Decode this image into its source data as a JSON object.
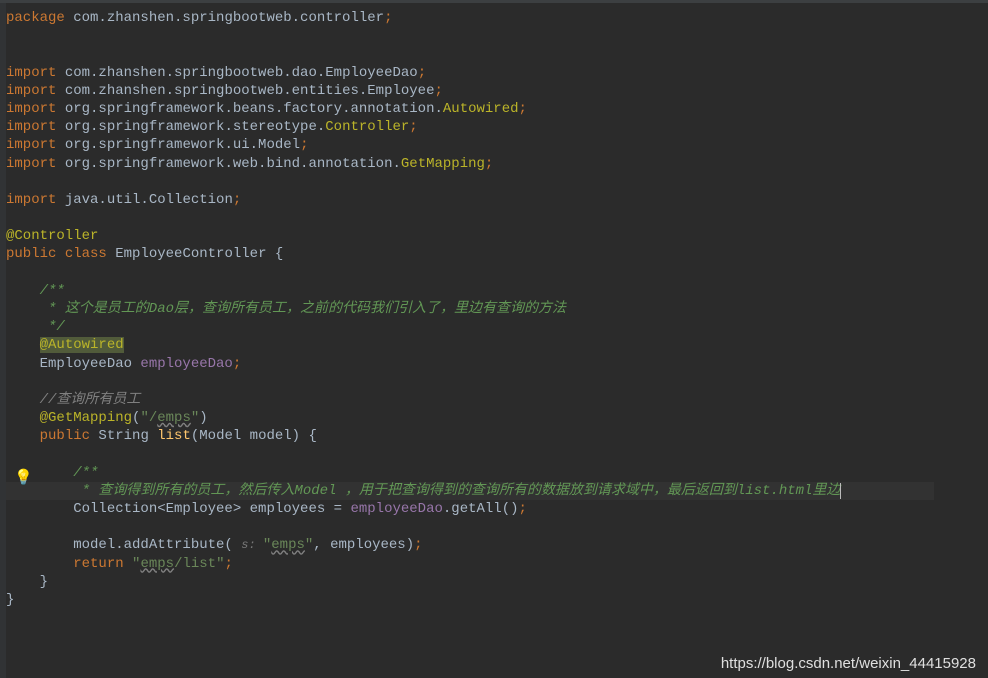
{
  "code": {
    "l1_kw": "package",
    "l1_pkg": " com.zhanshen.springbootweb.controller",
    "l3_kw": "import",
    "l3_pkg": " com.zhanshen.springbootweb.dao.EmployeeDao",
    "l4_kw": "import",
    "l4_pkg": " com.zhanshen.springbootweb.entities.Employee",
    "l5_kw": "import",
    "l5_pkg": " org.springframework.beans.factory.annotation.",
    "l5_cls": "Autowired",
    "l6_kw": "import",
    "l6_pkg": " org.springframework.stereotype.",
    "l6_cls": "Controller",
    "l7_kw": "import",
    "l7_pkg": " org.springframework.ui.Model",
    "l8_kw": "import",
    "l8_pkg": " org.springframework.web.bind.annotation.",
    "l8_cls": "GetMapping",
    "l10_kw": "import",
    "l10_pkg": " java.util.Collection",
    "l12_ann": "@Controller",
    "l13_kw1": "public",
    "l13_kw2": "class",
    "l13_cls": " EmployeeController {",
    "l15_c": "    /**",
    "l16_c": "     * 这个是员工的Dao层，查询所有员工，之前的代码我们引入了，里边有查询的方法",
    "l17_c": "     */",
    "l18_ann": "@Autowired",
    "l19_type": "    EmployeeDao ",
    "l19_field": "employeeDao",
    "l21_c": "    //查询所有员工",
    "l22_ann": "@GetMapping",
    "l22_p1": "(",
    "l22_s1": "\"/",
    "l22_s2": "emps",
    "l22_s3": "\"",
    "l22_p2": ")",
    "l23_kw": "public",
    "l23_t1": " String ",
    "l23_m": "list",
    "l23_t2": "(Model model) {",
    "l25_c": "        /**",
    "l26_c": "         * 查询得到所有的员工，然后传入Model ，用于把查询得到的查询所有的数据放到请求域中，最后返回到list.html里边",
    "l27_c": "         */",
    "l28_t1": "        Collection<Employee> employees = ",
    "l28_f": "employeeDao",
    "l28_t2": ".getAll()",
    "l30_t1": "        model.addAttribute( ",
    "l30_hint": "s: ",
    "l30_s1": "\"",
    "l30_s2": "emps",
    "l30_s3": "\"",
    "l30_t2": ", employees)",
    "l31_kw": "return",
    "l31_s1": "\"",
    "l31_s2": "emps",
    "l31_s3": "/list\"",
    "l32": "    }",
    "l33": "}"
  },
  "watermark": "https://blog.csdn.net/weixin_44415928",
  "bulb_icon": "💡"
}
